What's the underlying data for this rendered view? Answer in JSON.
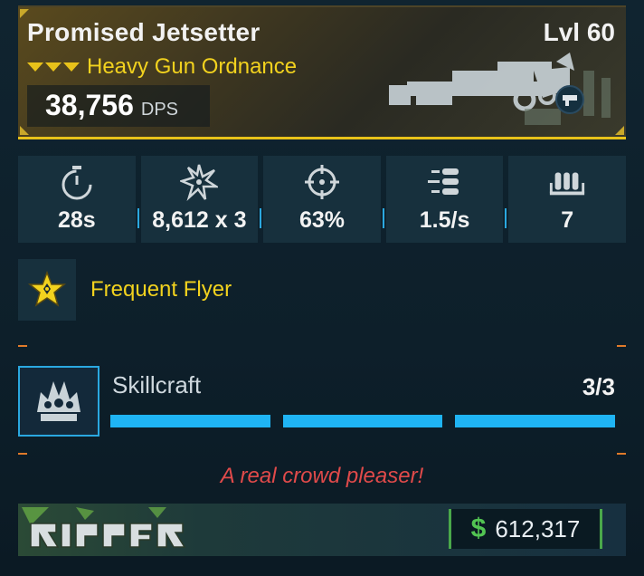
{
  "item": {
    "name": "Promised Jetsetter",
    "level": "Lvl 60",
    "type": "Heavy Gun Ordnance",
    "dps_value": "38,756",
    "dps_unit": "DPS",
    "rarity_color": "#e8c21a"
  },
  "stats": [
    {
      "icon": "stopwatch-icon",
      "value": "28s"
    },
    {
      "icon": "impact-burst-icon",
      "value": "8,612 x 3"
    },
    {
      "icon": "crosshair-icon",
      "value": "63%"
    },
    {
      "icon": "fire-rate-icon",
      "value": "1.5/s"
    },
    {
      "icon": "ammo-icon",
      "value": "7"
    }
  ],
  "perk": {
    "icon": "star-perk-icon",
    "name": "Frequent Flyer"
  },
  "skillcraft": {
    "label": "Skillcraft",
    "count": "3/3",
    "filled": 3,
    "total": 3,
    "accent": "#1fb4f4"
  },
  "flavor_text": "A real crowd pleaser!",
  "footer": {
    "manufacturer_logo": "ripper-logo",
    "price_icon": "$",
    "price": "612,317",
    "price_color": "#52c452"
  }
}
